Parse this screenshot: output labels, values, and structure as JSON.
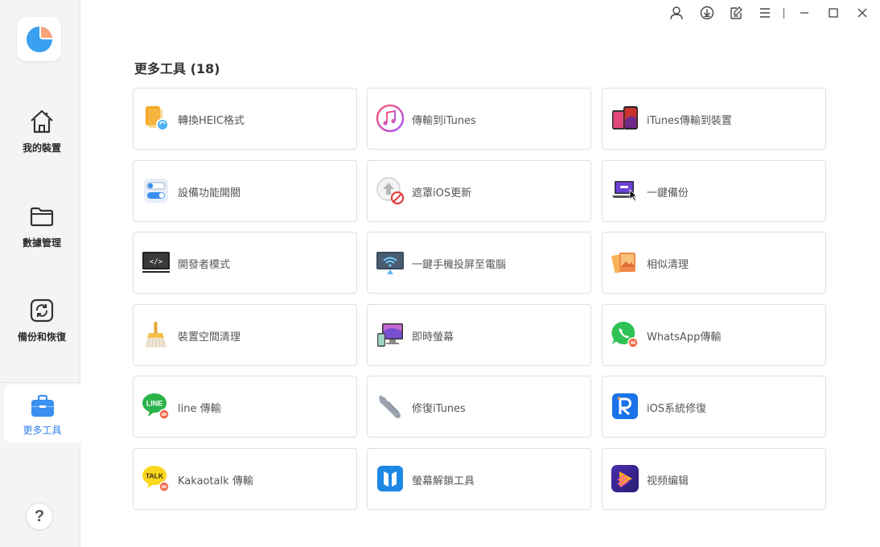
{
  "sidebar": {
    "items": [
      {
        "label": "我的裝置"
      },
      {
        "label": "數據管理"
      },
      {
        "label": "備份和恢復"
      },
      {
        "label": "更多工具"
      }
    ],
    "help_label": "?"
  },
  "main": {
    "title": "更多工具 (18)",
    "tools": [
      {
        "label": "轉換HEIC格式",
        "icon": "heic-convert-icon"
      },
      {
        "label": "傳輸到iTunes",
        "icon": "itunes-music-icon"
      },
      {
        "label": "iTunes傳輸到裝置",
        "icon": "phones-transfer-icon"
      },
      {
        "label": "設備功能開關",
        "icon": "toggle-switch-icon"
      },
      {
        "label": "遮罩iOS更新",
        "icon": "block-update-icon"
      },
      {
        "label": "一鍵備份",
        "icon": "laptop-backup-icon"
      },
      {
        "label": "開發者模式",
        "icon": "developer-monitor-icon"
      },
      {
        "label": "一鍵手機投屏至電腦",
        "icon": "screen-cast-icon"
      },
      {
        "label": "相似清理",
        "icon": "photos-clean-icon"
      },
      {
        "label": "裝置空間清理",
        "icon": "broom-icon"
      },
      {
        "label": "即時螢幕",
        "icon": "live-screen-icon"
      },
      {
        "label": "WhatsApp傳輸",
        "icon": "whatsapp-icon"
      },
      {
        "label": "line 傳輸",
        "icon": "line-app-icon"
      },
      {
        "label": "修復iTunes",
        "icon": "wrench-icon"
      },
      {
        "label": "iOS系統修復",
        "icon": "ios-repair-icon"
      },
      {
        "label": "Kakaotalk 傳輸",
        "icon": "kakaotalk-icon"
      },
      {
        "label": "螢幕解鎖工具",
        "icon": "screen-unlock-icon"
      },
      {
        "label": "视频编辑",
        "icon": "video-edit-icon"
      }
    ]
  },
  "colors": {
    "accent": "#2f80ed",
    "sidebar_bg": "#f3f4f6",
    "card_border": "#dcdfe4"
  }
}
